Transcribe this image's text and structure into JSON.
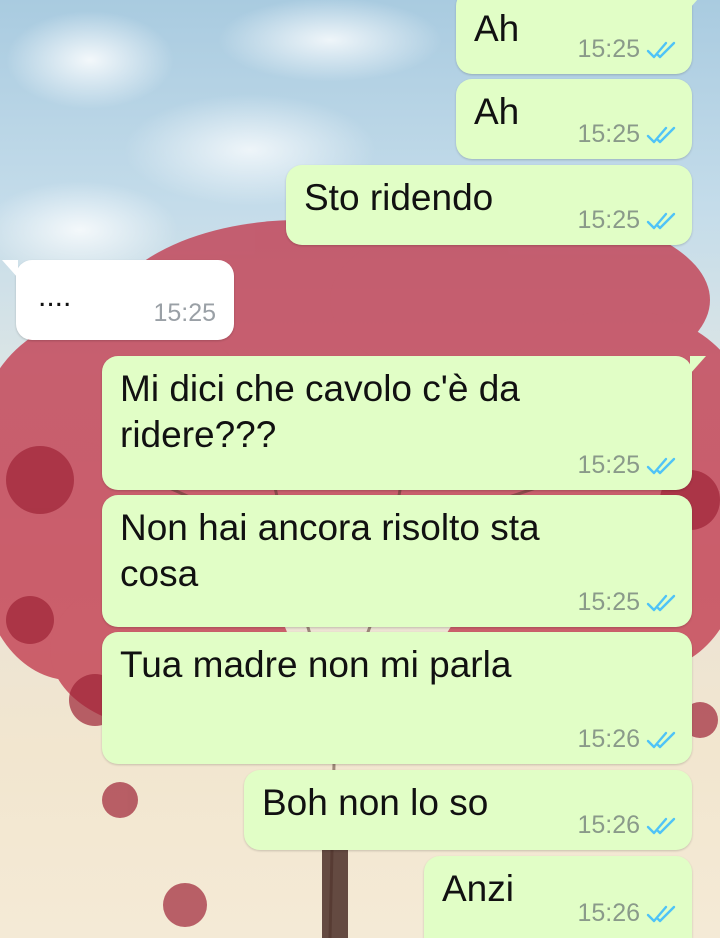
{
  "colors": {
    "outgoing_bubble": "#e1fec6",
    "incoming_bubble": "#ffffff",
    "read_ticks": "#4fc3f7",
    "timestamp": "#8a9a8a"
  },
  "messages": [
    {
      "direction": "out",
      "text": "Ah",
      "time": "15:25",
      "status_icon": "double-check-icon"
    },
    {
      "direction": "out",
      "text": "Ah",
      "time": "15:25",
      "status_icon": "double-check-icon"
    },
    {
      "direction": "out",
      "text": "Sto ridendo",
      "time": "15:25",
      "status_icon": "double-check-icon"
    },
    {
      "direction": "in",
      "text": "....",
      "time": "15:25"
    },
    {
      "direction": "out",
      "text": "Mi dici che cavolo c'è da ridere???",
      "time": "15:25",
      "status_icon": "double-check-icon"
    },
    {
      "direction": "out",
      "text": "Non hai ancora risolto sta cosa",
      "time": "15:25",
      "status_icon": "double-check-icon"
    },
    {
      "direction": "out",
      "text": "Tua madre non mi parla",
      "time": "15:26",
      "status_icon": "double-check-icon"
    },
    {
      "direction": "out",
      "text": "Boh non lo so",
      "time": "15:26",
      "status_icon": "double-check-icon"
    },
    {
      "direction": "out",
      "text": "Anzi",
      "time": "15:26",
      "status_icon": "double-check-icon"
    }
  ]
}
